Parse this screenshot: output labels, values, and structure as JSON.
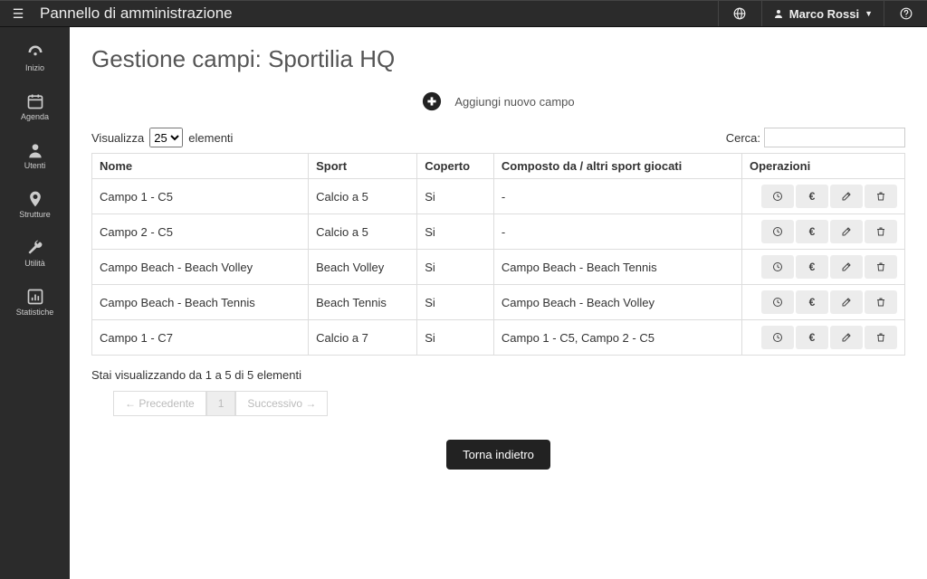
{
  "topbar": {
    "title": "Pannello di amministrazione",
    "user_name": "Marco Rossi"
  },
  "sidebar": {
    "items": [
      {
        "label": "Inizio"
      },
      {
        "label": "Agenda"
      },
      {
        "label": "Utenti"
      },
      {
        "label": "Strutture"
      },
      {
        "label": "Utilità"
      },
      {
        "label": "Statistiche"
      }
    ]
  },
  "page": {
    "heading": "Gestione campi: Sportilia HQ",
    "add_label": "Aggiungi nuovo campo",
    "show_label": "Visualizza",
    "entries_label": "elementi",
    "page_size": "25",
    "search_label": "Cerca:",
    "search_value": "",
    "columns": {
      "name": "Nome",
      "sport": "Sport",
      "covered": "Coperto",
      "composed": "Composto da / altri sport giocati",
      "ops": "Operazioni"
    },
    "rows": [
      {
        "name": "Campo 1 - C5",
        "sport": "Calcio a 5",
        "covered": "Si",
        "composed": "-"
      },
      {
        "name": "Campo 2 - C5",
        "sport": "Calcio a 5",
        "covered": "Si",
        "composed": "-"
      },
      {
        "name": "Campo Beach - Beach Volley",
        "sport": "Beach Volley",
        "covered": "Si",
        "composed": "Campo Beach - Beach Tennis"
      },
      {
        "name": "Campo Beach - Beach Tennis",
        "sport": "Beach Tennis",
        "covered": "Si",
        "composed": "Campo Beach - Beach Volley"
      },
      {
        "name": "Campo 1 - C7",
        "sport": "Calcio a 7",
        "covered": "Si",
        "composed": "Campo 1 - C5, Campo 2 - C5"
      }
    ],
    "info": "Stai visualizzando da 1 a 5 di 5 elementi",
    "prev": "← Precedente",
    "page_num": "1",
    "next": "Successivo →",
    "back": "Torna indietro"
  }
}
